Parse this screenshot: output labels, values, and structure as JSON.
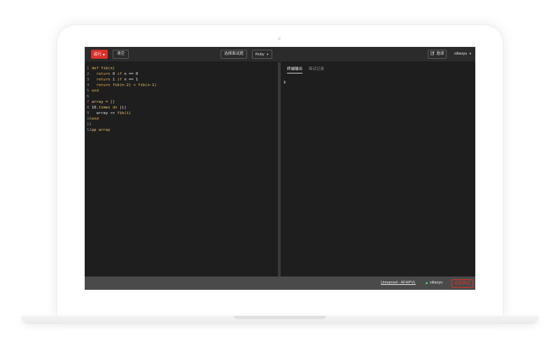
{
  "toolbar": {
    "run_label": "运行",
    "run_icon": "play-triangle",
    "clear_label": "清空",
    "select_question_label": "选择面试题",
    "language_label": "Ruby",
    "invite_label": "邀请",
    "invite_icon": "edit-icon",
    "user_label": "xiliaoyu",
    "accent_color": "#d9312a"
  },
  "editor": {
    "lines": [
      {
        "n": "1",
        "tokens": [
          {
            "t": "def ",
            "c": "kw"
          },
          {
            "t": "fib(n)",
            "c": "fn"
          }
        ]
      },
      {
        "n": "2",
        "tokens": [
          {
            "t": "  return ",
            "c": "kw"
          },
          {
            "t": "0 ",
            "c": "num"
          },
          {
            "t": "if ",
            "c": "kw"
          },
          {
            "t": "n == 0",
            "c": "txt"
          }
        ]
      },
      {
        "n": "3",
        "tokens": [
          {
            "t": "  return ",
            "c": "kw"
          },
          {
            "t": "1 ",
            "c": "num"
          },
          {
            "t": "if ",
            "c": "kw"
          },
          {
            "t": "n == 1",
            "c": "txt"
          }
        ]
      },
      {
        "n": "4",
        "tokens": [
          {
            "t": "  return ",
            "c": "kw"
          },
          {
            "t": "fib(n-2) + fib(n-1)",
            "c": "fn"
          }
        ]
      },
      {
        "n": "5",
        "tokens": [
          {
            "t": "end",
            "c": "kw"
          }
        ]
      },
      {
        "n": "6",
        "tokens": []
      },
      {
        "n": "7",
        "tokens": [
          {
            "t": "array = []",
            "c": "fn"
          }
        ]
      },
      {
        "n": "8",
        "tokens": [
          {
            "t": "10",
            "c": "txt"
          },
          {
            "t": ".times ",
            "c": "fn"
          },
          {
            "t": "do ",
            "c": "kw"
          },
          {
            "t": "|i|",
            "c": "txt"
          }
        ]
      },
      {
        "n": "9",
        "tokens": [
          {
            "t": "  array << ",
            "c": "txt"
          },
          {
            "t": "fib(i)",
            "c": "fn"
          }
        ]
      },
      {
        "n": "10",
        "tokens": [
          {
            "t": "end",
            "c": "kw"
          }
        ]
      },
      {
        "n": "11",
        "tokens": []
      },
      {
        "n": "12",
        "tokens": [
          {
            "t": "pp array",
            "c": "fn"
          }
        ]
      }
    ]
  },
  "output": {
    "tab_console": "终端输出",
    "tab_record": "面试记录",
    "content": "$"
  },
  "statusbar": {
    "file_name": "Unnamed - AFHPVL",
    "online_user": "xiliaoyu",
    "online_color": "#3fcf6a",
    "end_label": "结束面试"
  }
}
